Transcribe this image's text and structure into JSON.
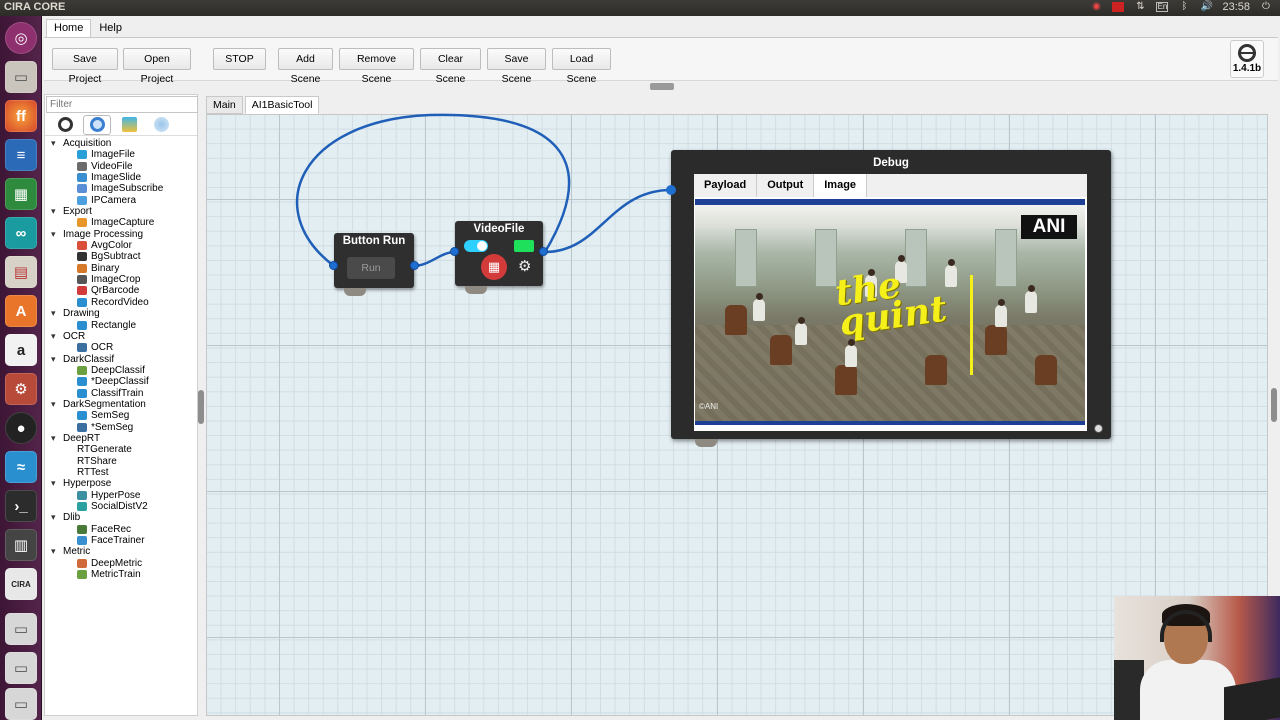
{
  "topbar": {
    "title": "CIRA CORE",
    "time": "23:58",
    "lang": "En"
  },
  "menu": {
    "tabs": [
      "Home",
      "Help"
    ]
  },
  "toolbar": {
    "buttons": [
      "Save Project",
      "Open Project",
      "STOP",
      "Add Scene",
      "Remove Scene",
      "Clear Scene",
      "Save Scene",
      "Load Scene"
    ],
    "version": "1.4.1b"
  },
  "sidebar": {
    "filter_placeholder": "Filter",
    "categories": [
      {
        "name": "Acquisition",
        "items": [
          "ImageFile",
          "VideoFile",
          "ImageSlide",
          "ImageSubscribe",
          "IPCamera"
        ]
      },
      {
        "name": "Export",
        "items": [
          "ImageCapture"
        ]
      },
      {
        "name": "Image Processing",
        "items": [
          "AvgColor",
          "BgSubtract",
          "Binary",
          "ImageCrop",
          "QrBarcode",
          "RecordVideo"
        ]
      },
      {
        "name": "Drawing",
        "items": [
          "Rectangle"
        ]
      },
      {
        "name": "OCR",
        "items": [
          "OCR"
        ]
      },
      {
        "name": "DarkClassif",
        "items": [
          "DeepClassif",
          "*DeepClassif",
          "ClassifTrain"
        ]
      },
      {
        "name": "DarkSegmentation",
        "items": [
          "SemSeg",
          "*SemSeg"
        ]
      },
      {
        "name": "DeepRT",
        "items": [
          "RTGenerate",
          "RTShare",
          "RTTest"
        ]
      },
      {
        "name": "Hyperpose",
        "items": [
          "HyperPose",
          "SocialDistV2"
        ]
      },
      {
        "name": "Dlib",
        "items": [
          "FaceRec",
          "FaceTrainer"
        ]
      },
      {
        "name": "Metric",
        "items": [
          "DeepMetric",
          "MetricTrain"
        ]
      }
    ]
  },
  "scene_tabs": [
    "Main",
    "AI1BasicTool"
  ],
  "nodes": {
    "button_run": {
      "title": "Button Run",
      "run_label": "Run"
    },
    "videofile": {
      "title": "VideoFile"
    }
  },
  "debug": {
    "title": "Debug",
    "tabs": [
      "Payload",
      "Output",
      "Image"
    ],
    "active_tab": "Image",
    "image": {
      "logo": "ANI",
      "overlay_text_1": "the",
      "overlay_text_2": "quint",
      "watermark": "©ANI"
    }
  },
  "colors": {
    "wire": "#1f5fb8",
    "grid": "#e3eef2",
    "launcher": "#54244a"
  }
}
